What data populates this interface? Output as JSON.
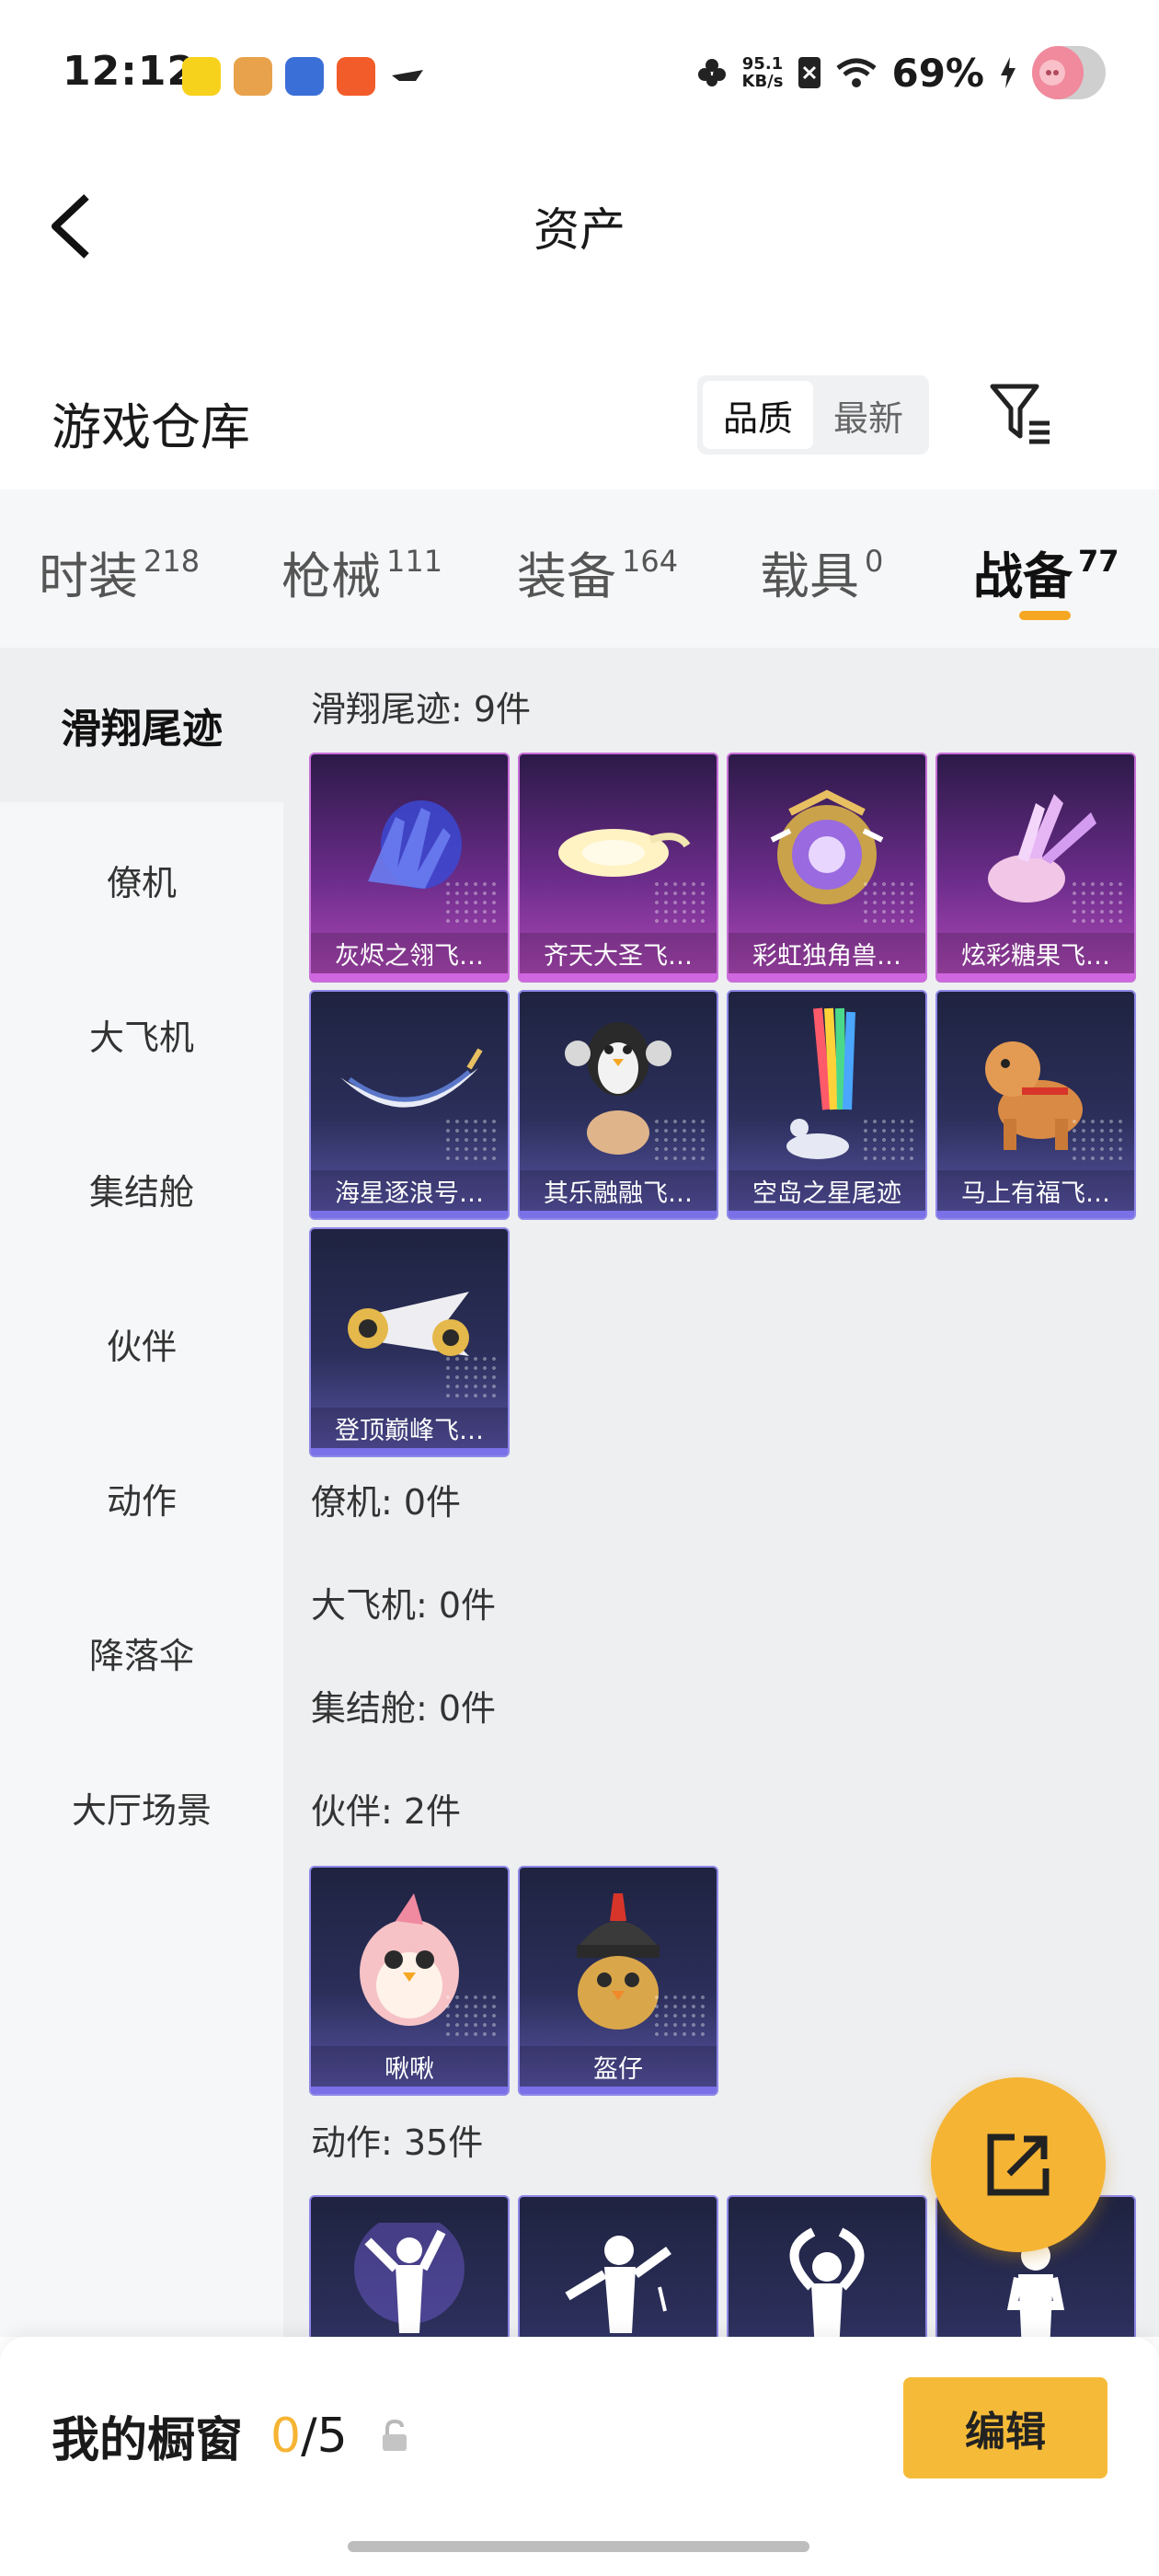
{
  "status_bar": {
    "time": "12:12",
    "speed_value": "95.1",
    "speed_unit": "KB/s",
    "battery": "69%"
  },
  "nav": {
    "title": "资产"
  },
  "warehouse": {
    "title": "游戏仓库",
    "sort": [
      "品质",
      "最新"
    ],
    "active_sort": "品质"
  },
  "tabs": [
    {
      "label": "时装",
      "count": "218"
    },
    {
      "label": "枪械",
      "count": "111"
    },
    {
      "label": "装备",
      "count": "164"
    },
    {
      "label": "载具",
      "count": "0"
    },
    {
      "label": "战备",
      "count": "77"
    }
  ],
  "sidebar": [
    "滑翔尾迹",
    "僚机",
    "大飞机",
    "集结舱",
    "伙伴",
    "动作",
    "降落伞",
    "大厅场景"
  ],
  "sections": {
    "glide": {
      "title": "滑翔尾迹: 9件",
      "items": [
        "灰烬之翎飞…",
        "齐天大圣飞…",
        "彩虹独角兽…",
        "炫彩糖果飞…",
        "海星逐浪号…",
        "其乐融融飞…",
        "空岛之星尾迹",
        "马上有福飞…",
        "登顶巅峰飞…"
      ]
    },
    "wingman": {
      "title": "僚机: 0件"
    },
    "plane": {
      "title": "大飞机: 0件"
    },
    "pod": {
      "title": "集结舱: 0件"
    },
    "partner": {
      "title": "伙伴: 2件",
      "items": [
        "啾啾",
        "盔仔"
      ]
    },
    "emote": {
      "title": "动作: 35件"
    }
  },
  "bottom": {
    "showcase_label": "我的橱窗",
    "showcase_used": "0",
    "showcase_total": "/5",
    "edit_label": "编辑"
  },
  "colors": {
    "accent": "#f5b433",
    "purple_quality": "#b14ab8",
    "blue_quality": "#5a55a8"
  }
}
